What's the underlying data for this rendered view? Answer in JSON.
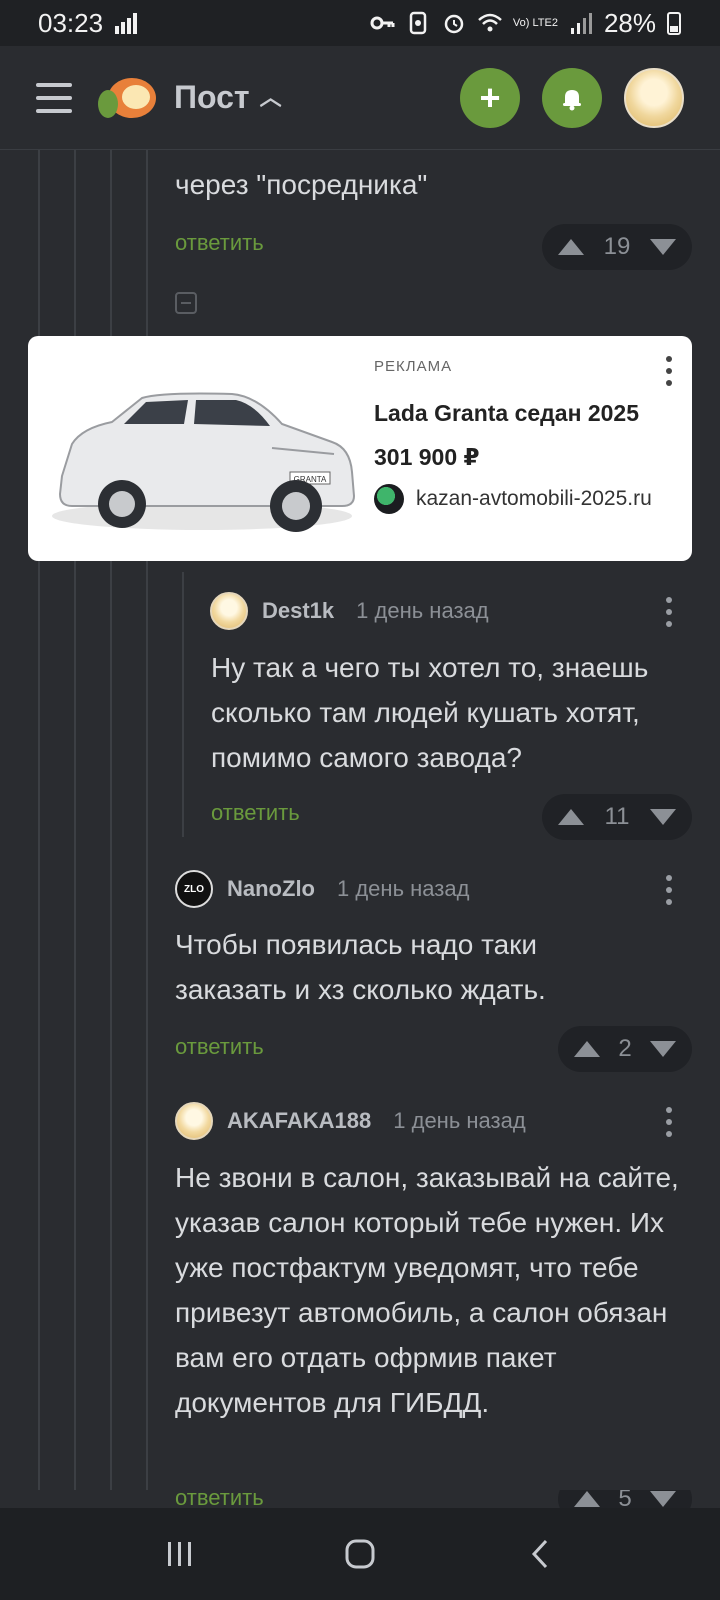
{
  "status": {
    "time": "03:23",
    "network": "Vo) LTE2",
    "battery": "28%"
  },
  "header": {
    "title": "Пост",
    "add_label": "+",
    "add_icon": "plus-icon",
    "notify_icon": "bell-icon"
  },
  "comments": {
    "partial_text": "через \"посредника\"",
    "partial_reply": "ответить",
    "partial_votes": "19",
    "c1": {
      "author": "Dest1k",
      "time": "1 день назад",
      "text": "Ну так а чего ты хотел то, знаешь сколько там людей кушать хотят, помимо самого завода?",
      "reply": "ответить",
      "votes": "11"
    },
    "c2": {
      "author": "NanoZlo",
      "time": "1 день назад",
      "text": "Чтобы появилась надо таки заказать и хз сколько ждать.",
      "reply": "ответить",
      "votes": "2",
      "avatar_text": "ZLO"
    },
    "c3": {
      "author": "AKAFAKA188",
      "time": "1 день назад",
      "text": "Не звони в салон, заказывай на сайте, указав салон который тебе нужен. Их уже постфактум уведомят, что тебе привезут автомобиль, а салон обязан вам его отдать офрмив пакет документов для ГИБДД.",
      "reply": "ответить",
      "votes": "5"
    }
  },
  "ad": {
    "label": "РЕКЛАМА",
    "title": "Lada Granta седан 2025",
    "price": "301 900 ₽",
    "site": "kazan-avtomobili-2025.ru",
    "plate": "GRANTA"
  }
}
